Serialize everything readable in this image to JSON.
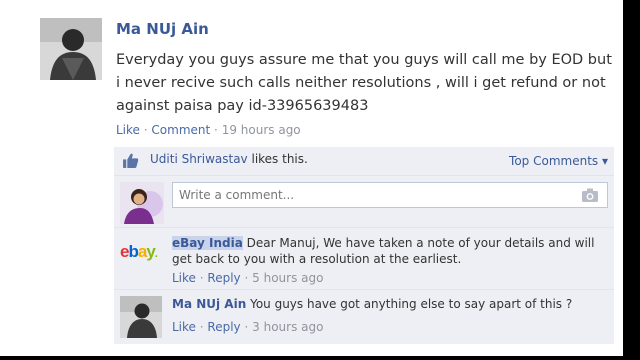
{
  "post": {
    "author": "Ma NUj Ain",
    "text": "Everyday you guys assure me that you guys will call me by EOD but i never recive such calls neither resolutions , will i get refund or not against paisa pay id-33965639483",
    "actions": {
      "like": "Like",
      "sep": "·",
      "comment": "Comment",
      "time": "19 hours ago"
    }
  },
  "likes": {
    "name": "Uditi Shriwastav",
    "suffix": " likes this.",
    "top_comments": "Top Comments ▾"
  },
  "composer": {
    "placeholder": "Write a comment...",
    "icon": "camera-icon"
  },
  "comments": [
    {
      "author": "eBay India",
      "text": "Dear Manuj, We have taken a note of your details and will get back to you with a resolution at the earliest.",
      "like": "Like",
      "reply": "Reply",
      "time": "5 hours ago",
      "logo": {
        "e": "e",
        "b": "b",
        "a": "a",
        "y": "y",
        "dot": "."
      }
    },
    {
      "author": "Ma NUj Ain",
      "text": "You guys have got anything else to say apart of this ?",
      "like": "Like",
      "reply": "Reply",
      "time": "3 hours ago"
    }
  ],
  "colors": {
    "link": "#3b5998",
    "panel": "#edeff4",
    "meta": "#90949c"
  }
}
